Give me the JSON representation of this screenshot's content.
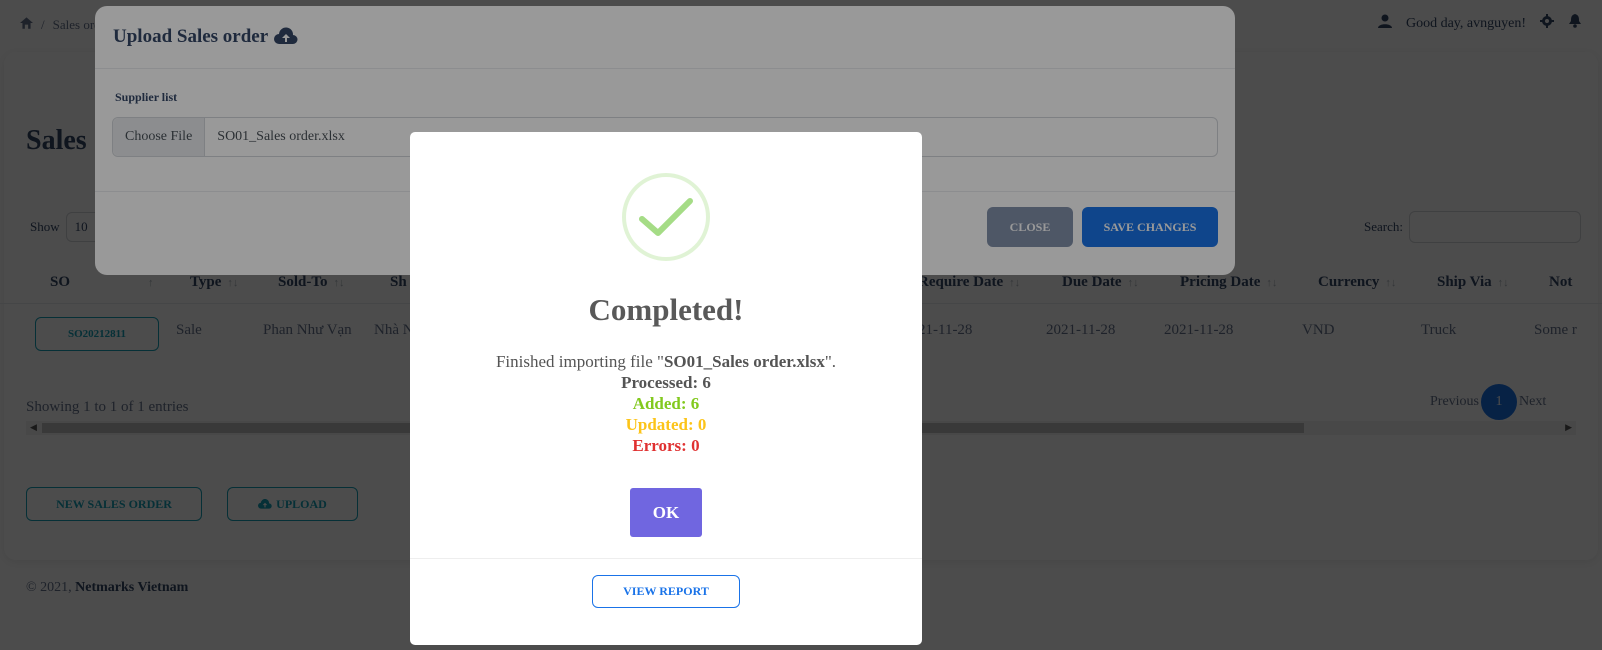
{
  "breadcrumb": {
    "sep": "/",
    "current": "Sales ord"
  },
  "user": {
    "greeting": "Good day, avnguyen!"
  },
  "page": {
    "title": "Sales"
  },
  "table_controls": {
    "show_label": "Show",
    "show_value": "10",
    "search_label": "Search:"
  },
  "table": {
    "headers": [
      "SO",
      "Type",
      "Sold-To",
      "Sh",
      "Require Date",
      "Due Date",
      "Pricing Date",
      "Currency",
      "Ship Via",
      "Not"
    ],
    "row": {
      "so": "SO20212811",
      "type": "Sale",
      "sold_to": "Phan Như Vạn",
      "ship": "Nhà N",
      "require_date": "21-11-28",
      "due_date": "2021-11-28",
      "pricing_date": "2021-11-28",
      "currency": "VND",
      "ship_via": "Truck",
      "note": "Some r"
    }
  },
  "entries_text": "Showing 1 to 1 of 1 entries",
  "pager": {
    "previous": "Previous",
    "current": "1",
    "next": "Next"
  },
  "actions": {
    "new_order": "NEW SALES ORDER",
    "upload": "UPLOAD"
  },
  "footer": {
    "copyright": "© 2021,",
    "company": "Netmarks Vietnam"
  },
  "upload_modal": {
    "title": "Upload Sales order",
    "field_label": "Supplier list",
    "choose_file": "Choose File",
    "file_name": "SO01_Sales order.xlsx",
    "close": "CLOSE",
    "save": "SAVE CHANGES"
  },
  "result_dialog": {
    "title": "Completed!",
    "message_prefix": "Finished importing file \"",
    "file": "SO01_Sales order.xlsx",
    "message_suffix": "\".",
    "processed": "Processed: 6",
    "added": "Added: 6",
    "updated": "Updated: 0",
    "errors": "Errors: 0",
    "ok": "OK",
    "view_report": "VIEW REPORT"
  },
  "colors": {
    "primary": "#1a73e8",
    "info": "#17a2b8",
    "success_check": "#a5dc86",
    "ok_button": "#7066e0",
    "added": "#82c91e",
    "updated": "#fcc419",
    "errors": "#e03131"
  },
  "icons": [
    "home-icon",
    "user-icon",
    "gear-icon",
    "bell-icon",
    "cloud-upload-icon",
    "check-icon",
    "sort-icon"
  ]
}
